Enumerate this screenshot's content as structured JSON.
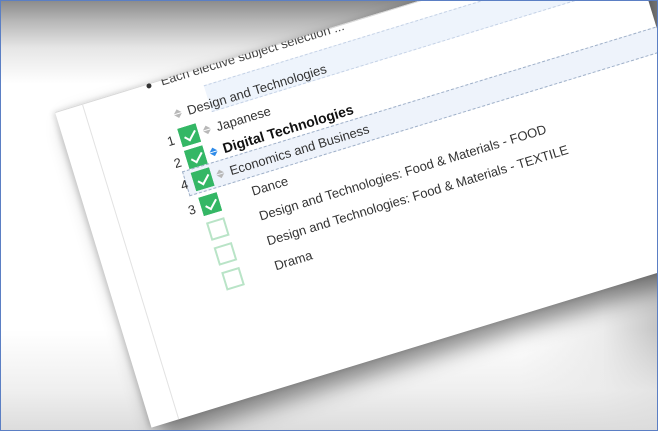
{
  "intro_text": "Each elective subject selection ...",
  "items": [
    {
      "number": "",
      "label": "Design and Technologies",
      "checked": false,
      "sortable": true,
      "bold": false
    },
    {
      "number": "1",
      "label": "Japanese",
      "checked": true,
      "sortable": true,
      "bold": false
    },
    {
      "number": "2",
      "label": "Digital Technologies",
      "checked": true,
      "sortable": true,
      "bold": true
    },
    {
      "number": "4",
      "label": "Economics and Business",
      "checked": true,
      "sortable": true,
      "bold": false
    },
    {
      "number": "3",
      "label": "Dance",
      "checked": true,
      "sortable": false,
      "bold": false
    },
    {
      "number": "",
      "label": "Design and Technologies: Food & Materials - FOOD",
      "checked": false,
      "sortable": false,
      "bold": false
    },
    {
      "number": "",
      "label": "Design and Technologies: Food & Materials - TEXTILE",
      "checked": false,
      "sortable": false,
      "bold": false
    },
    {
      "number": "",
      "label": "Drama",
      "checked": false,
      "sortable": false,
      "bold": false
    }
  ],
  "colors": {
    "checked_green": "#34b765",
    "unchecked_border": "#b9e4c7",
    "active_sort_blue": "#2f8be8"
  },
  "icons": {
    "checkbox": "checkmark-icon",
    "sort": "sort-arrows-icon"
  }
}
